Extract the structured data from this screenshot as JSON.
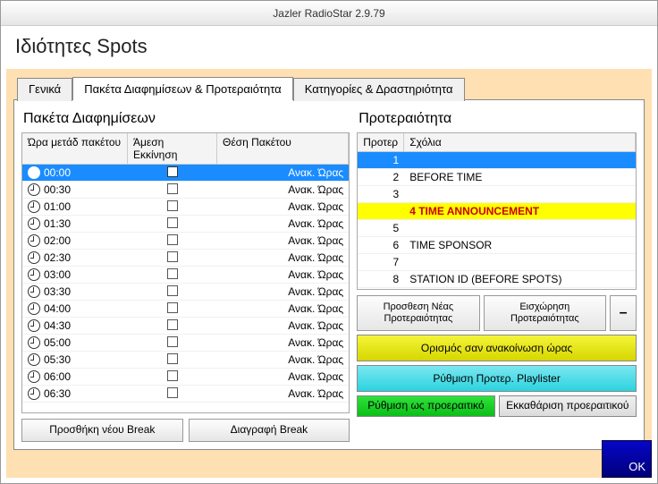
{
  "window_title": "Jazler RadioStar 2.9.79",
  "page_title": "Ιδιότητες Spots",
  "tabs": {
    "general": "Γενικά",
    "packages": "Πακέτα Διαφημίσεων & Προτεραιότητα",
    "categories": "Κατηγορίες & Δραστηριότητα"
  },
  "left": {
    "title": "Πακέτα Διαφημίσεων",
    "cols": {
      "time": "Ώρα μετάδ πακέτου",
      "instant": "Άμεση Εκκίνηση",
      "pos": "Θέση Πακέτου"
    },
    "pos_value": "Ανακ. Ώρας",
    "rows": [
      {
        "time": "00:00",
        "sel": true
      },
      {
        "time": "00:30"
      },
      {
        "time": "01:00"
      },
      {
        "time": "01:30"
      },
      {
        "time": "02:00"
      },
      {
        "time": "02:30"
      },
      {
        "time": "03:00"
      },
      {
        "time": "03:30"
      },
      {
        "time": "04:00"
      },
      {
        "time": "04:30"
      },
      {
        "time": "05:00"
      },
      {
        "time": "05:30"
      },
      {
        "time": "06:00"
      },
      {
        "time": "06:30"
      }
    ],
    "add": "Προσθήκη νέου Break",
    "del": "Διαγραφή Break"
  },
  "right": {
    "title": "Προτεραιότητα",
    "cols": {
      "prio": "Προτερ",
      "comment": "Σχόλια"
    },
    "rows": [
      {
        "n": "1",
        "c": "",
        "sel": true
      },
      {
        "n": "2",
        "c": "BEFORE TIME"
      },
      {
        "n": "3",
        "c": ""
      },
      {
        "n": "4",
        "c": "TIME ANNOUNCEMENT",
        "hl": true
      },
      {
        "n": "5",
        "c": ""
      },
      {
        "n": "6",
        "c": "TIME SPONSOR"
      },
      {
        "n": "7",
        "c": ""
      },
      {
        "n": "8",
        "c": "STATION ID (BEFORE SPOTS)"
      }
    ],
    "btns": {
      "add": "Προσθεση Νέας Προτεραιότητας",
      "insert": "Εισχώρηση Προτεραιότητας",
      "minus": "–",
      "announce": "Ορισμός σαν ανακοίνωση ώρας",
      "playlister": "Ρύθμιση Προτερ. Playlister",
      "optional": "Ρύθμιση ως προεραιτικό",
      "clear": "Εκκαθάριση προεραιτικού"
    }
  },
  "ok": "OK"
}
